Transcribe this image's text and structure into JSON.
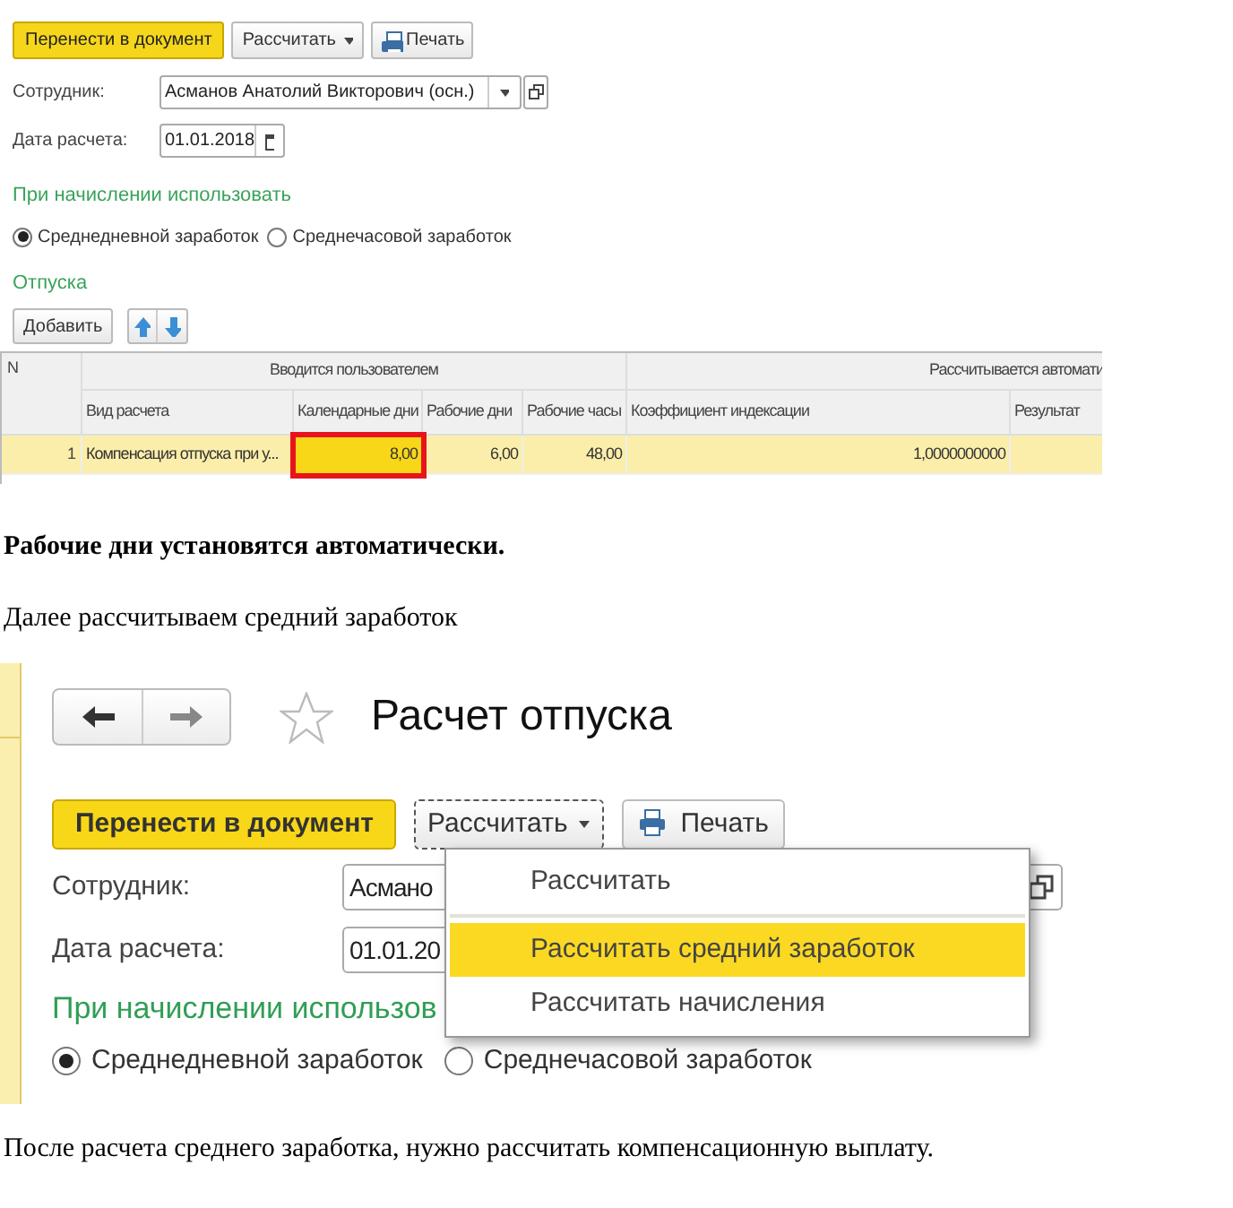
{
  "screenshot_1": {
    "buttons": [
      {
        "kind": "primary",
        "label": "Перенести в документ"
      },
      {
        "kind": "dropdown",
        "label": "Рассчитать",
        "focused": false
      },
      {
        "kind": "print",
        "label": "Печать"
      }
    ],
    "employee": {
      "label": "Сотрудник:",
      "value": "Асманов Анатолий Викторович (осн.)"
    },
    "date": {
      "label": "Дата расчета:",
      "value": "01.01.2018"
    },
    "use_title": "При начислении использовать",
    "radios": [
      {
        "label": "Среднедневной заработок",
        "selected": true
      },
      {
        "label": "Среднечасовой заработок",
        "selected": false
      }
    ],
    "vacation_title": "Отпуска",
    "add_button": "Добавить",
    "table": {
      "number_column": "N",
      "groups": [
        "Вводится пользователем",
        "Рассчитывается автомати"
      ],
      "columns": [
        "Вид расчета",
        "Календарные дни",
        "Рабочие дни",
        "Рабочие часы",
        "Коэффициент индексации",
        "Результат"
      ],
      "rows": [
        {
          "number": "1",
          "selected": true,
          "cells": [
            {
              "text": "Компенсация отпуска при у...",
              "highlighted": false
            },
            {
              "text": "8,00",
              "highlighted": true
            },
            {
              "text": "6,00",
              "highlighted": false
            },
            {
              "text": "48,00",
              "highlighted": false
            },
            {
              "text": "1,0000000000",
              "highlighted": false
            }
          ]
        }
      ]
    }
  },
  "paragraph_1": "Рабочие дни установятся автоматически.",
  "paragraph_2": "Далее рассчитываем средний заработок",
  "screenshot_2": {
    "title": "Расчет отпуска",
    "buttons": [
      {
        "kind": "primary",
        "label": "Перенести в документ"
      },
      {
        "kind": "dropdown",
        "label": "Рассчитать",
        "focused": true
      },
      {
        "kind": "print",
        "label": "Печать"
      }
    ],
    "employee": {
      "label": "Сотрудник:",
      "value": "Асмано"
    },
    "date": {
      "label": "Дата расчета:",
      "value": "01.01.20"
    },
    "use_title": "При начислении использов",
    "radios": [
      {
        "label": "Среднедневной заработок",
        "selected": true
      },
      {
        "label": "Среднечасовой заработок",
        "selected": false
      }
    ],
    "menu": {
      "items": [
        {
          "label": "Рассчитать",
          "selected": false
        },
        {
          "label": "Рассчитать средний заработок",
          "selected": true
        },
        {
          "label": "Рассчитать начисления",
          "selected": false
        }
      ]
    }
  },
  "paragraph_3": "После расчета среднего заработка, нужно рассчитать компенсационную выплату."
}
